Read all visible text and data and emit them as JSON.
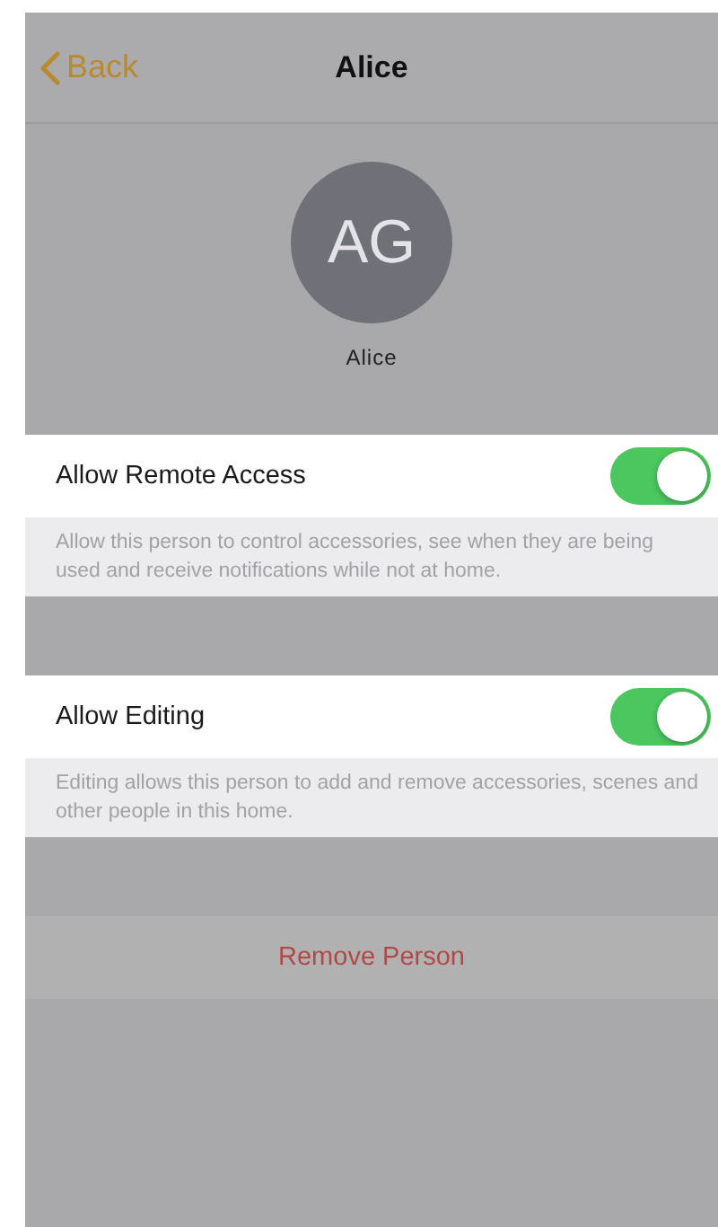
{
  "nav": {
    "back": "Back",
    "title": "Alice"
  },
  "profile": {
    "initials": "AG",
    "name": "Alice"
  },
  "settings": [
    {
      "label": "Allow Remote Access",
      "on": true,
      "description": "Allow this person to control accessories, see when they are being used and receive notifications while not at home."
    },
    {
      "label": "Allow Editing",
      "on": true,
      "description": "Editing allows this person to add and remove accessories, scenes and other people in this home."
    }
  ],
  "remove_button": "Remove Person"
}
